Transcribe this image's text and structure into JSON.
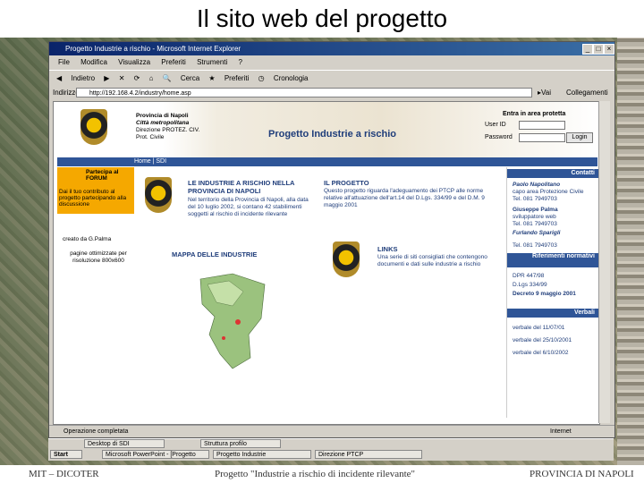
{
  "slide": {
    "title": "Il sito web del progetto",
    "footer_left": "MIT – DICOTER",
    "footer_center": "Progetto \"Industrie a rischio di incidente rilevante\"",
    "footer_right": "PROVINCIA DI NAPOLI"
  },
  "browser": {
    "window_title": "Progetto Industrie a rischio - Microsoft Internet Explorer",
    "menu": [
      "File",
      "Modifica",
      "Visualizza",
      "Preferiti",
      "Strumenti",
      "?"
    ],
    "toolbar": [
      "Indietro",
      "Cerca",
      "Preferiti",
      "Cronologia"
    ],
    "address_label": "Indirizzo",
    "address_value": "http://192.168.4.2/industry/home.asp",
    "go_label": "Vai",
    "links_label": "Collegamenti",
    "status_left": "Operazione completata",
    "status_right": "Internet"
  },
  "page": {
    "org_line1": "Provincia di Napoli",
    "org_line2": "Città metropolitana",
    "org_line3": "Direzione PROTEZ. CIV.",
    "org_line4": "Prot. Civile",
    "site_title": "Progetto Industrie a rischio",
    "login_title": "Entra in area protetta",
    "user_label": "User ID",
    "password_label": "Password",
    "login_button": "Login",
    "nav": "Home | SDI",
    "forum_title": "Partecipa al FORUM",
    "forum_text": "Dai il tuo contributo al progetto partecipando alla discussione",
    "credit_text": "creato da G.Palma",
    "view_text": "pagine ottimizzate per risoluzione 800x600",
    "industries_title": "LE INDUSTRIE A RISCHIO NELLA PROVINCIA DI NAPOLI",
    "industries_text": "Nel territorio della Provincia di Napoli, alla data del 10 luglio 2002, si contano 42 stabilimenti soggetti al rischio di incidente rilevante",
    "project_title": "IL PROGETTO",
    "project_text": "Questo progetto riguarda l'adeguamento dei PTCP alle norme relative all'attuazione dell'art.14 del D.Lgs. 334/99 e del D.M. 9 maggio 2001",
    "map_title": "MAPPA DELLE INDUSTRIE",
    "links_title": "LINKS",
    "links_text": "Una serie di siti consigliati che contengono documenti e dati sulle industrie a rischio",
    "contacts_head": "Contatti",
    "contact1_name": "Paolo Napolitano",
    "contact1_text": "capo area Protezione Civile",
    "contact1_tel": "Tel. 081 7949703",
    "contact2_name": "Giuseppe Palma",
    "contact2_text": "sviluppatore web",
    "contact2_tel": "Tel. 081 7949703",
    "contact3_name": "Furlando Sparigli",
    "contact3_tel": "Tel. 081 7949703",
    "norm_head": "Riferimenti normativi",
    "norm1": "DPR 447/98",
    "norm2": "D.Lgs 334/99",
    "norm3": "Decreto 9 maggio 2001",
    "verbali_head": "Verbali",
    "verb1": "verbale del 11/07/01",
    "verb2": "verbale del 25/10/2001",
    "verb3": "verbale del 6/10/2002"
  },
  "taskbar": {
    "start": "Start",
    "row1": [
      "Desktop di SDI",
      "Struttura profilo"
    ],
    "row2": [
      "Microsoft PowerPoint - [Progetto",
      "Progetto Industrie",
      "Direzione PTCP"
    ]
  }
}
